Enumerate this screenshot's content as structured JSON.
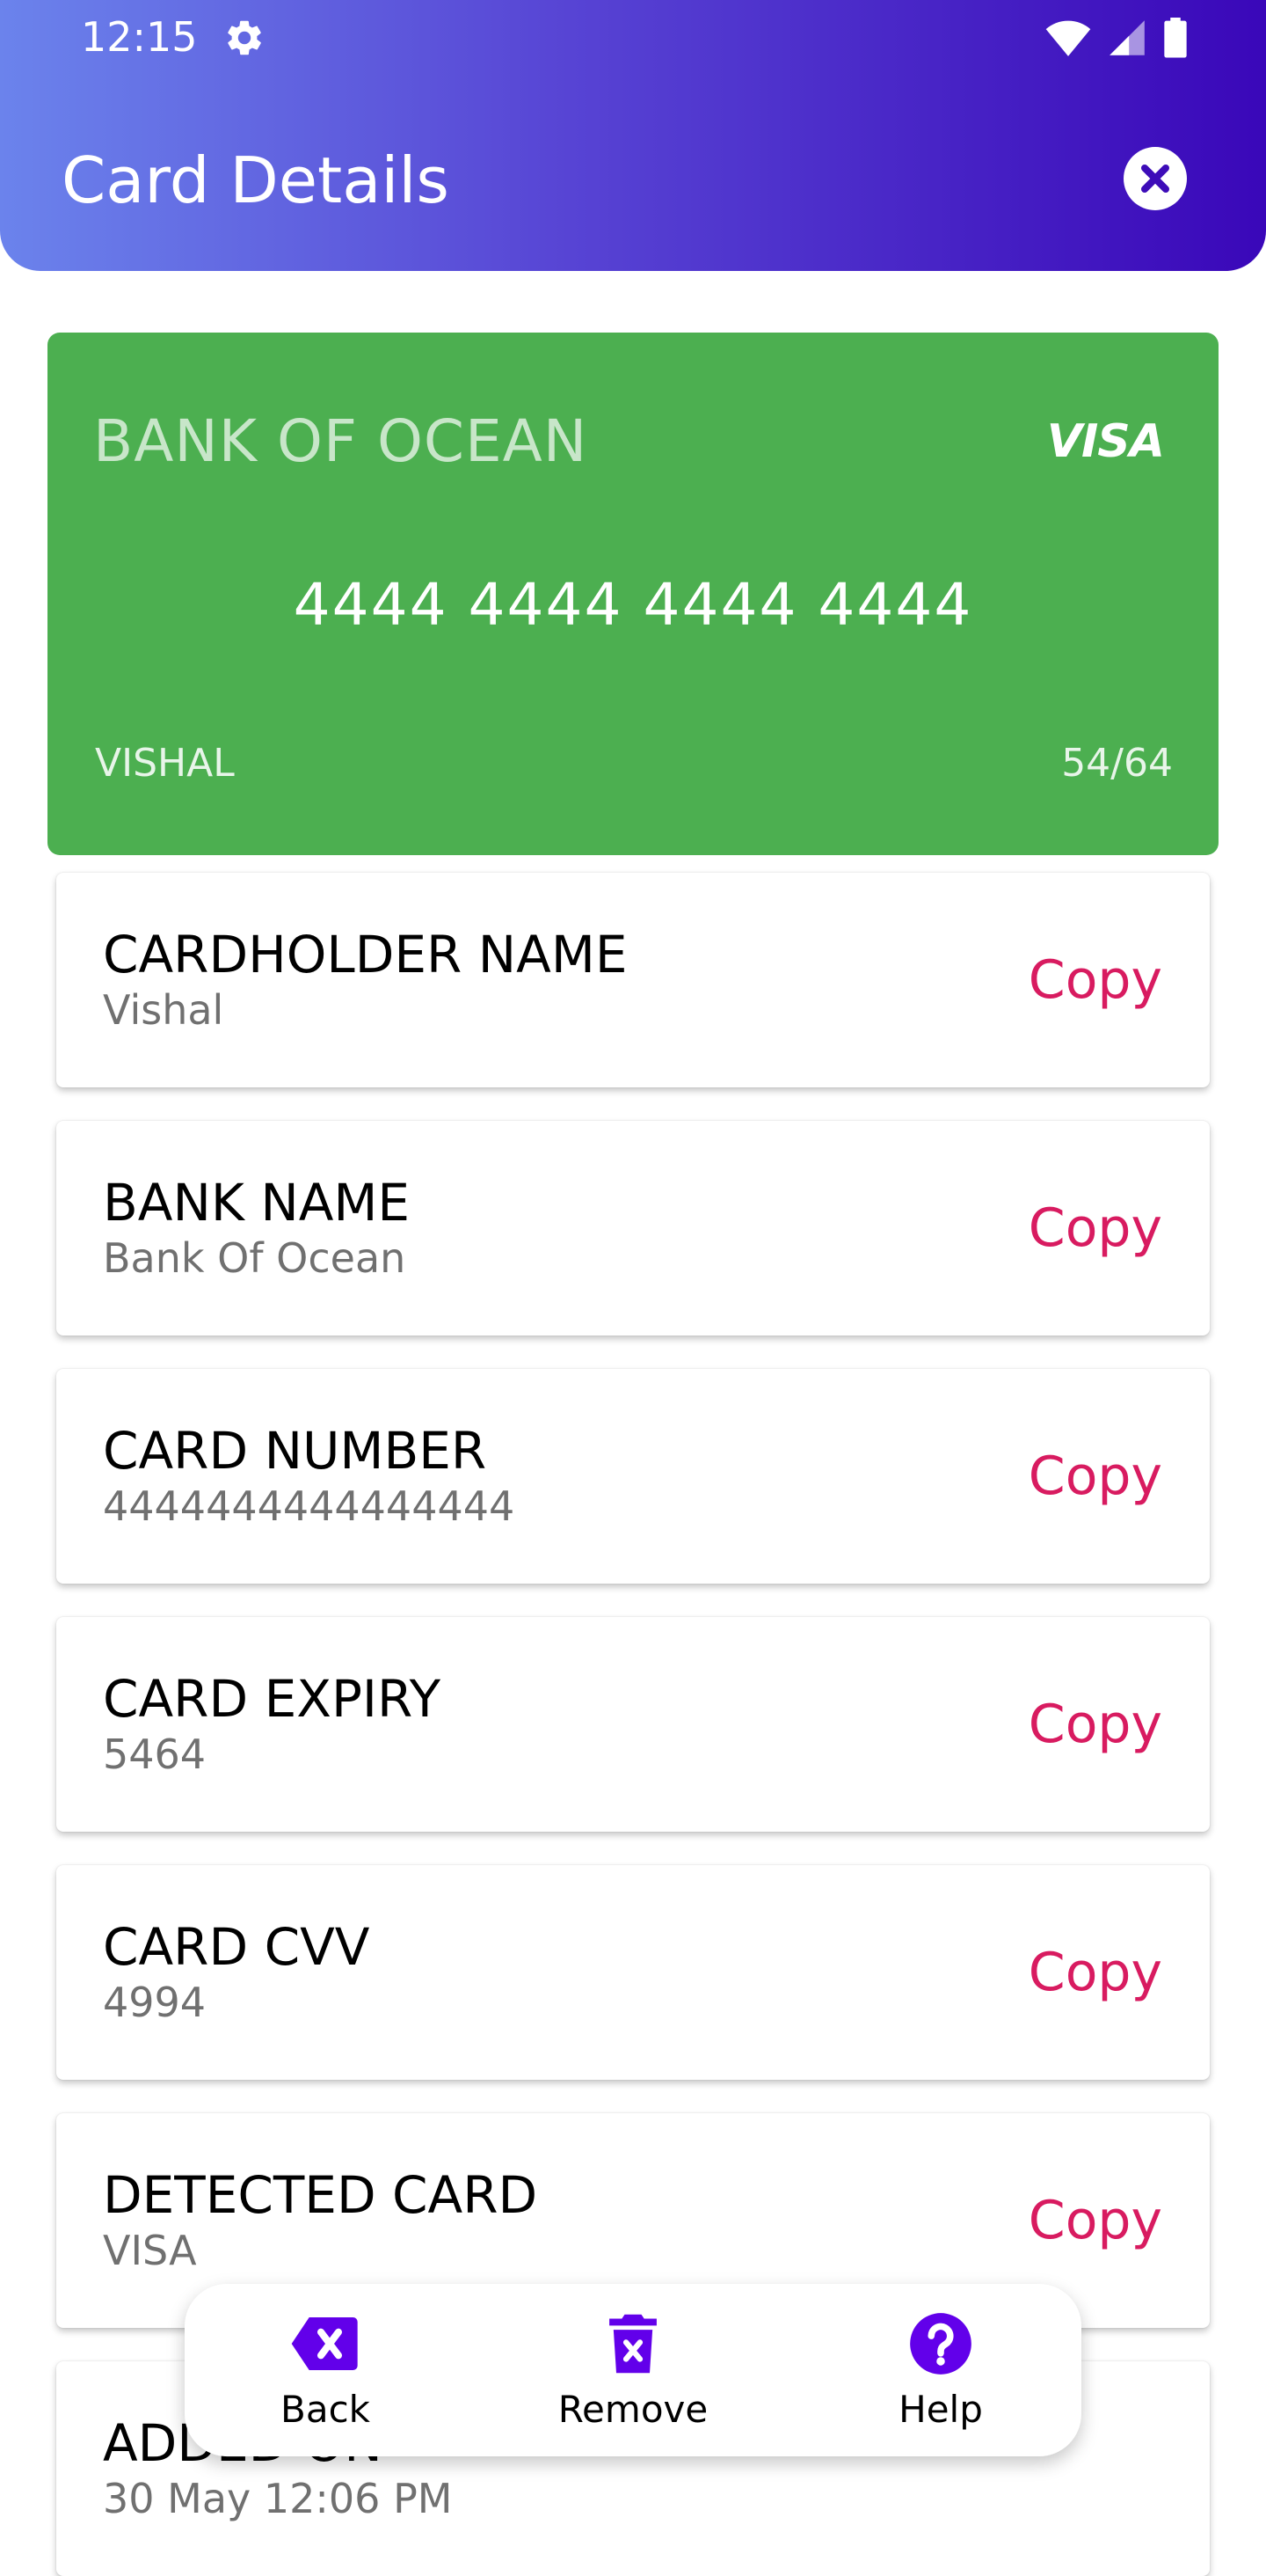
{
  "status_bar": {
    "time": "12:15"
  },
  "header": {
    "title": "Card Details"
  },
  "card": {
    "bank": "BANK OF OCEAN",
    "brand": "VISA",
    "number": "4444 4444 4444 4444",
    "holder": "VISHAL",
    "expiry": "54/64",
    "color": "#4caf50"
  },
  "details": [
    {
      "label": "CARDHOLDER NAME",
      "value": "Vishal",
      "action": "Copy"
    },
    {
      "label": "BANK NAME",
      "value": "Bank Of Ocean",
      "action": "Copy"
    },
    {
      "label": "CARD NUMBER",
      "value": "4444444444444444",
      "action": "Copy"
    },
    {
      "label": "CARD EXPIRY",
      "value": "5464",
      "action": "Copy"
    },
    {
      "label": "CARD CVV",
      "value": "4994",
      "action": "Copy"
    },
    {
      "label": "DETECTED CARD",
      "value": "VISA",
      "action": "Copy"
    },
    {
      "label": "ADDED ON",
      "value": "30 May 12:06 PM"
    }
  ],
  "bottom_nav": {
    "items": [
      {
        "label": "Back",
        "icon": "backspace-icon"
      },
      {
        "label": "Remove",
        "icon": "trash-icon"
      },
      {
        "label": "Help",
        "icon": "help-icon"
      }
    ]
  },
  "colors": {
    "accent": "#6200ea",
    "copy": "#d81b60",
    "header_start": "#6b83ec",
    "header_end": "#3a07b9"
  }
}
